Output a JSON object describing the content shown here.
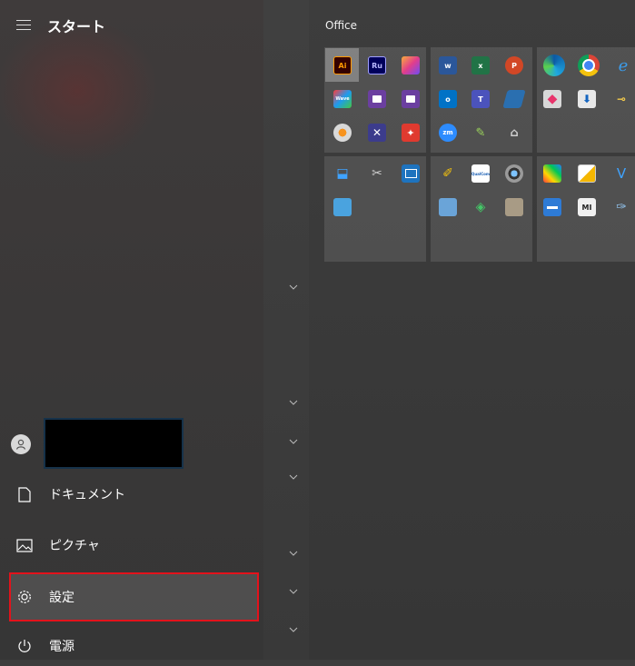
{
  "header": {
    "title": "スタート"
  },
  "tiles": {
    "group_label": "Office"
  },
  "left_menu": {
    "documents": "ドキュメント",
    "pictures": "ピクチャ",
    "settings": "設定",
    "power": "電源"
  },
  "colors": {
    "highlight_border": "#e3121b"
  }
}
